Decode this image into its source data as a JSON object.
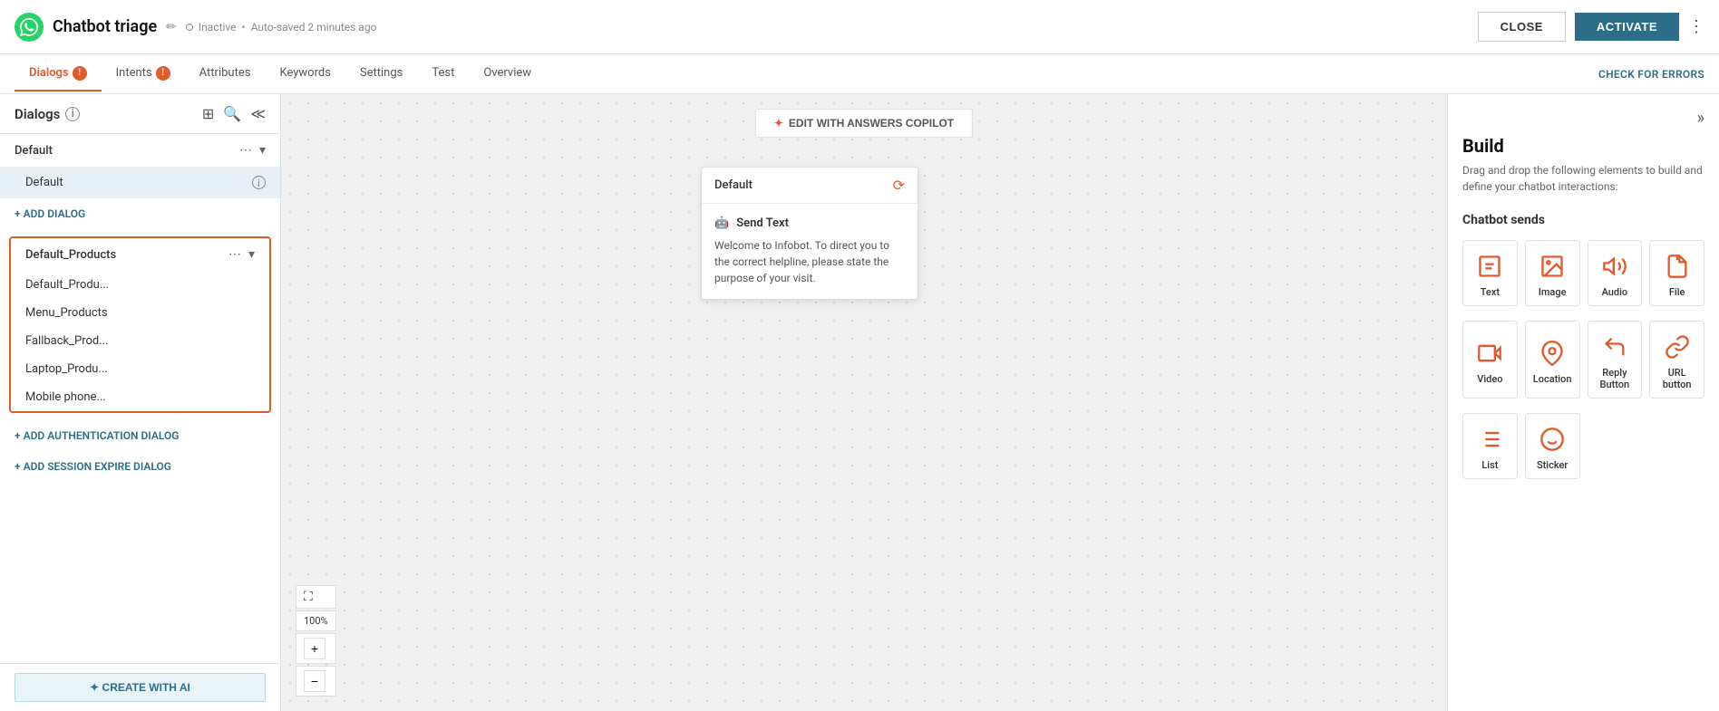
{
  "header": {
    "app_title": "Chatbot triage",
    "status": "Inactive",
    "autosave": "Auto-saved 2 minutes ago",
    "close_label": "CLOSE",
    "activate_label": "ACTIVATE"
  },
  "nav": {
    "tabs": [
      {
        "id": "dialogs",
        "label": "Dialogs",
        "active": true,
        "warn": true
      },
      {
        "id": "intents",
        "label": "Intents",
        "active": false,
        "warn": true
      },
      {
        "id": "attributes",
        "label": "Attributes",
        "active": false,
        "warn": false
      },
      {
        "id": "keywords",
        "label": "Keywords",
        "active": false,
        "warn": false
      },
      {
        "id": "settings",
        "label": "Settings",
        "active": false,
        "warn": false
      },
      {
        "id": "test",
        "label": "Test",
        "active": false,
        "warn": false
      },
      {
        "id": "overview",
        "label": "Overview",
        "active": false,
        "warn": false
      }
    ],
    "check_errors": "CHECK FOR ERRORS"
  },
  "sidebar": {
    "title": "Dialogs",
    "groups": [
      {
        "id": "default",
        "label": "Default",
        "active": false,
        "items": [
          {
            "label": "Default",
            "active": true
          }
        ]
      },
      {
        "id": "default_products",
        "label": "Default_Products",
        "selected": true,
        "items": [
          {
            "label": "Default_Produ..."
          },
          {
            "label": "Menu_Products"
          },
          {
            "label": "Fallback_Prod..."
          },
          {
            "label": "Laptop_Produ..."
          },
          {
            "label": "Mobile phone..."
          }
        ]
      }
    ],
    "add_dialog": "+ ADD DIALOG",
    "add_auth_dialog": "+ ADD AUTHENTICATION DIALOG",
    "add_session_dialog": "+ ADD SESSION EXPIRE DIALOG",
    "create_ai": "✦ CREATE WITH AI"
  },
  "canvas": {
    "copilot_btn": "EDIT WITH ANSWERS COPILOT",
    "zoom_label": "100%",
    "dialog_title": "Default",
    "send_text_title": "Send Text",
    "send_text_body": "Welcome to Infobot. To direct you to the correct helpline, please state the purpose of your visit."
  },
  "build_panel": {
    "collapse_icon": "»",
    "title": "Build",
    "desc": "Drag and drop the following elements to build and define your chatbot interactions:",
    "section_chatbot_sends": "Chatbot sends",
    "items_row1": [
      {
        "id": "text",
        "label": "Text",
        "icon": "text"
      },
      {
        "id": "image",
        "label": "Image",
        "icon": "image"
      },
      {
        "id": "audio",
        "label": "Audio",
        "icon": "audio"
      },
      {
        "id": "file",
        "label": "File",
        "icon": "file"
      }
    ],
    "items_row2": [
      {
        "id": "video",
        "label": "Video",
        "icon": "video"
      },
      {
        "id": "location",
        "label": "Location",
        "icon": "location"
      },
      {
        "id": "reply_button",
        "label": "Reply Button",
        "icon": "reply"
      },
      {
        "id": "url_button",
        "label": "URL button",
        "icon": "url"
      }
    ],
    "items_row3": [
      {
        "id": "list",
        "label": "List",
        "icon": "list"
      },
      {
        "id": "sticker",
        "label": "Sticker",
        "icon": "sticker"
      }
    ]
  }
}
